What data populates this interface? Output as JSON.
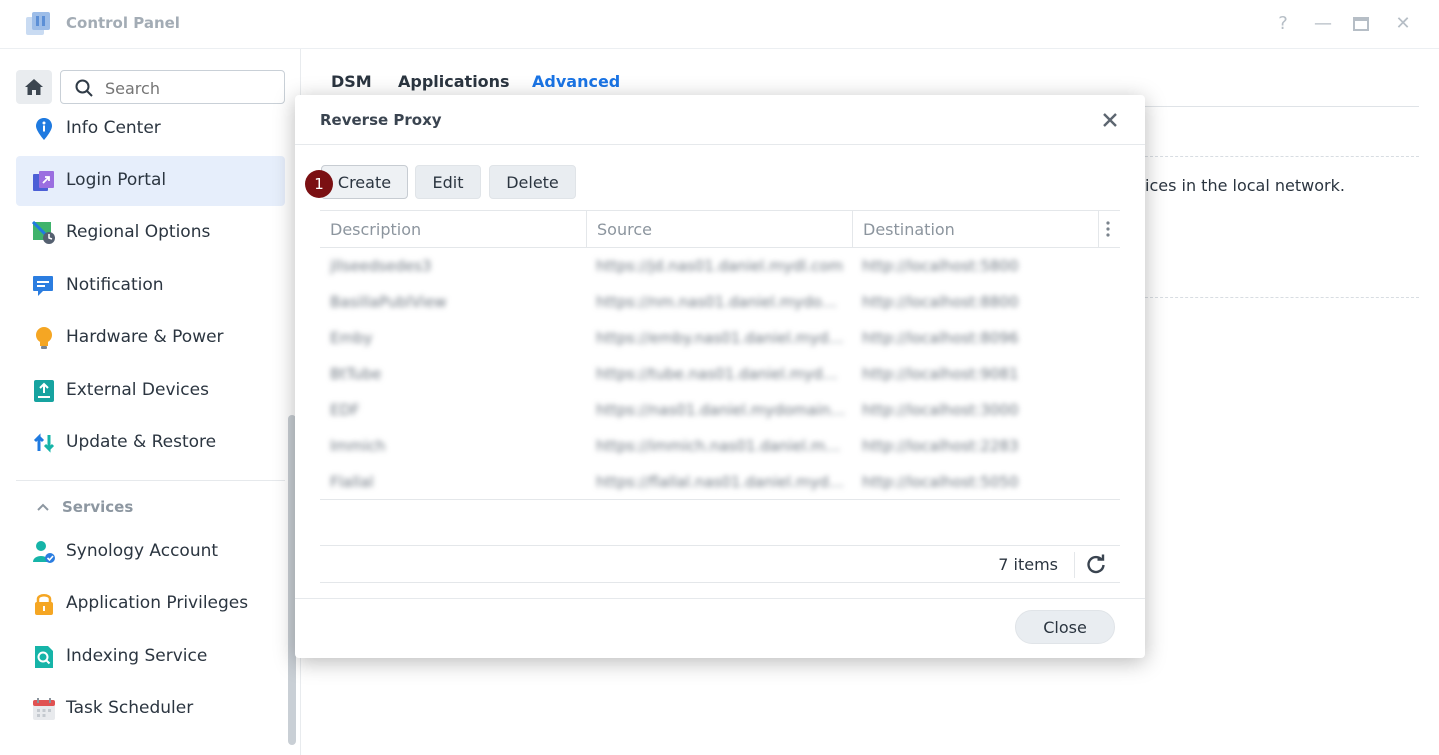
{
  "window": {
    "title": "Control Panel",
    "help": "?",
    "minimize": "—",
    "close": "✕"
  },
  "sidebar": {
    "search_placeholder": "Search",
    "items": [
      {
        "label": "Info Center",
        "icon": "info-icon"
      },
      {
        "label": "Login Portal",
        "icon": "login-portal-icon",
        "active": true
      },
      {
        "label": "Regional Options",
        "icon": "regional-options-icon"
      },
      {
        "label": "Notification",
        "icon": "notification-icon"
      },
      {
        "label": "Hardware & Power",
        "icon": "lightbulb-icon"
      },
      {
        "label": "External Devices",
        "icon": "external-devices-icon"
      },
      {
        "label": "Update & Restore",
        "icon": "update-restore-icon"
      }
    ],
    "services_header": "Services",
    "services": [
      {
        "label": "Synology Account",
        "icon": "synology-account-icon"
      },
      {
        "label": "Application Privileges",
        "icon": "lock-icon"
      },
      {
        "label": "Indexing Service",
        "icon": "indexing-icon"
      },
      {
        "label": "Task Scheduler",
        "icon": "calendar-icon"
      }
    ]
  },
  "main": {
    "tabs": [
      "DSM",
      "Applications",
      "Advanced"
    ],
    "active_tab": "Advanced",
    "description_tail": "ices in the local network."
  },
  "modal": {
    "title": "Reverse Proxy",
    "buttons": {
      "create": "Create",
      "edit": "Edit",
      "delete": "Delete",
      "close": "Close"
    },
    "step_badge": "1",
    "columns": [
      "Description",
      "Source",
      "Destination"
    ],
    "rows": [
      {
        "description": "jllseedsedes3",
        "source": "https://jd.nas01.daniel.mydl.com",
        "destination": "http://localhost:5800"
      },
      {
        "description": "BasillaPublView",
        "source": "https://nm.nas01.daniel.mydomain",
        "destination": "http://localhost:8800"
      },
      {
        "description": "Emby",
        "source": "https://emby.nas01.daniel.mydomain",
        "destination": "http://localhost:8096"
      },
      {
        "description": "BtTube",
        "source": "https://tube.nas01.daniel.mydomain",
        "destination": "http://localhost:9081"
      },
      {
        "description": "EDF",
        "source": "https://nas01.daniel.mydomain.com",
        "destination": "http://localhost:3000"
      },
      {
        "description": "Immich",
        "source": "https://immich.nas01.daniel.mydomain",
        "destination": "http://localhost:2283"
      },
      {
        "description": "Flallal",
        "source": "https://flallal.nas01.daniel.mydomain",
        "destination": "http://localhost:5050"
      }
    ],
    "item_count": "7 items"
  },
  "colors": {
    "accent": "#1a74e5",
    "active_bg": "#e6eefb",
    "badge": "#7b1013"
  }
}
